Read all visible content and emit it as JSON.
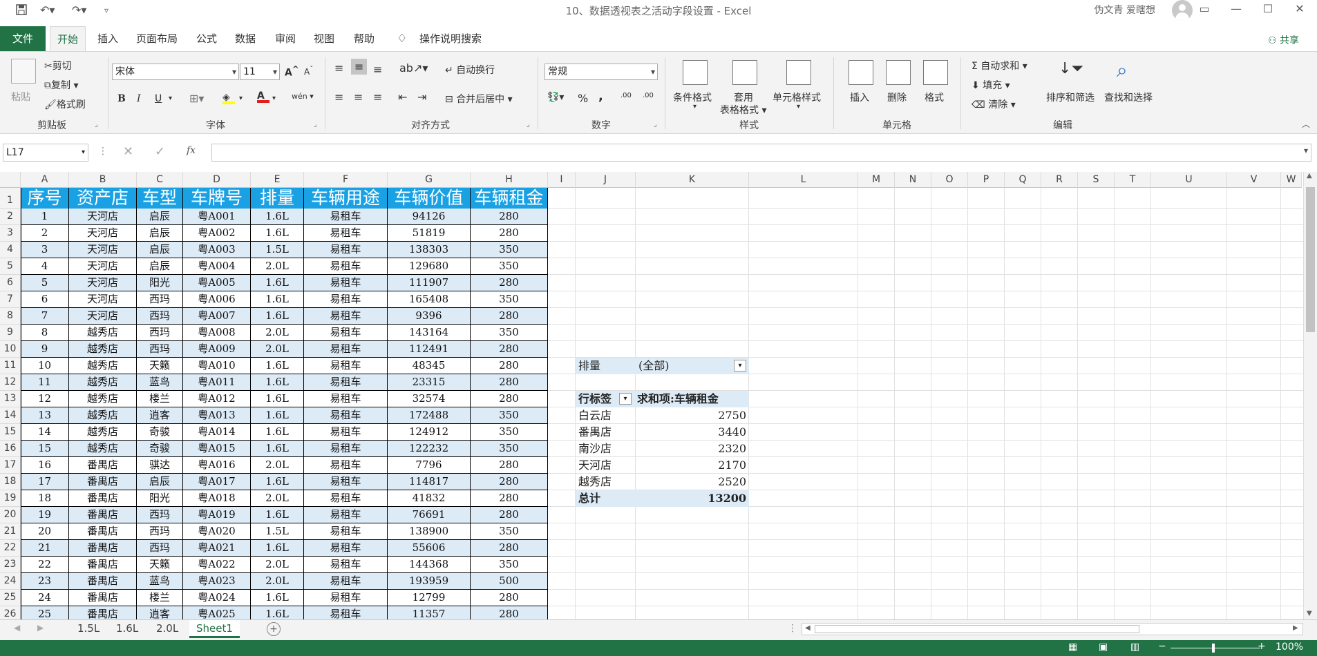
{
  "title_bar": {
    "doc_title": "10、数据透视表之活动字段设置 - Excel",
    "user": "伪文青 爱瞎想",
    "icons": [
      "save-icon",
      "undo-icon",
      "redo-icon",
      "customize-qat-icon",
      "ribbon-display-icon",
      "minimize-icon",
      "maximize-icon",
      "close-icon"
    ]
  },
  "tabs": {
    "file": "文件",
    "items": [
      "开始",
      "插入",
      "页面布局",
      "公式",
      "数据",
      "审阅",
      "视图",
      "帮助"
    ],
    "tell_me": "操作说明搜索",
    "share": "共享"
  },
  "ribbon": {
    "clipboard": {
      "paste": "粘贴",
      "cut": "剪切",
      "copy": "复制",
      "format_painter": "格式刷",
      "label": "剪贴板"
    },
    "font": {
      "name": "宋体",
      "size": "11",
      "label": "字体",
      "bold": "B",
      "italic": "I",
      "underline": "U",
      "grow": "A",
      "shrink": "A",
      "font_color_letter": "A",
      "phonetic": "wén"
    },
    "alignment": {
      "wrap": "自动换行",
      "merge": "合并后居中",
      "label": "对齐方式"
    },
    "number": {
      "format": "常规",
      "percent": "%",
      "comma": ",",
      "inc_dec": ".00",
      "label": "数字"
    },
    "styles": {
      "conditional": "条件格式",
      "table_format_1": "套用",
      "table_format_2": "表格格式",
      "cell_styles": "单元格样式",
      "label": "样式"
    },
    "cells": {
      "insert": "插入",
      "delete": "删除",
      "format": "格式",
      "label": "单元格"
    },
    "editing": {
      "autosum": "自动求和",
      "fill": "填充",
      "clear": "清除",
      "sort_filter": "排序和筛选",
      "find_select": "查找和选择",
      "label": "编辑"
    }
  },
  "formula_bar": {
    "name_box": "L17",
    "fx": "fx",
    "value": ""
  },
  "sheet": {
    "columns": [
      "A",
      "B",
      "C",
      "D",
      "E",
      "F",
      "G",
      "H",
      "I",
      "J",
      "K",
      "L",
      "M",
      "N",
      "O",
      "P",
      "Q",
      "R",
      "S",
      "T",
      "U",
      "V",
      "W"
    ],
    "headers": [
      "序号",
      "资产店",
      "车型",
      "车牌号",
      "排量",
      "车辆用途",
      "车辆价值",
      "车辆租金"
    ],
    "rows": [
      [
        "1",
        "天河店",
        "启辰",
        "粤A001",
        "1.6L",
        "易租车",
        "94126",
        "280"
      ],
      [
        "2",
        "天河店",
        "启辰",
        "粤A002",
        "1.6L",
        "易租车",
        "51819",
        "280"
      ],
      [
        "3",
        "天河店",
        "启辰",
        "粤A003",
        "1.5L",
        "易租车",
        "138303",
        "350"
      ],
      [
        "4",
        "天河店",
        "启辰",
        "粤A004",
        "2.0L",
        "易租车",
        "129680",
        "350"
      ],
      [
        "5",
        "天河店",
        "阳光",
        "粤A005",
        "1.6L",
        "易租车",
        "111907",
        "280"
      ],
      [
        "6",
        "天河店",
        "西玛",
        "粤A006",
        "1.6L",
        "易租车",
        "165408",
        "350"
      ],
      [
        "7",
        "天河店",
        "西玛",
        "粤A007",
        "1.6L",
        "易租车",
        "9396",
        "280"
      ],
      [
        "8",
        "越秀店",
        "西玛",
        "粤A008",
        "2.0L",
        "易租车",
        "143164",
        "350"
      ],
      [
        "9",
        "越秀店",
        "西玛",
        "粤A009",
        "2.0L",
        "易租车",
        "112491",
        "280"
      ],
      [
        "10",
        "越秀店",
        "天籁",
        "粤A010",
        "1.6L",
        "易租车",
        "48345",
        "280"
      ],
      [
        "11",
        "越秀店",
        "蓝鸟",
        "粤A011",
        "1.6L",
        "易租车",
        "23315",
        "280"
      ],
      [
        "12",
        "越秀店",
        "楼兰",
        "粤A012",
        "1.6L",
        "易租车",
        "32574",
        "280"
      ],
      [
        "13",
        "越秀店",
        "逍客",
        "粤A013",
        "1.6L",
        "易租车",
        "172488",
        "350"
      ],
      [
        "14",
        "越秀店",
        "奇骏",
        "粤A014",
        "1.6L",
        "易租车",
        "124912",
        "350"
      ],
      [
        "15",
        "越秀店",
        "奇骏",
        "粤A015",
        "1.6L",
        "易租车",
        "122232",
        "350"
      ],
      [
        "16",
        "番禺店",
        "骐达",
        "粤A016",
        "2.0L",
        "易租车",
        "7796",
        "280"
      ],
      [
        "17",
        "番禺店",
        "启辰",
        "粤A017",
        "1.6L",
        "易租车",
        "114817",
        "280"
      ],
      [
        "18",
        "番禺店",
        "阳光",
        "粤A018",
        "2.0L",
        "易租车",
        "41832",
        "280"
      ],
      [
        "19",
        "番禺店",
        "西玛",
        "粤A019",
        "1.6L",
        "易租车",
        "76691",
        "280"
      ],
      [
        "20",
        "番禺店",
        "西玛",
        "粤A020",
        "1.5L",
        "易租车",
        "138900",
        "350"
      ],
      [
        "21",
        "番禺店",
        "西玛",
        "粤A021",
        "1.6L",
        "易租车",
        "55606",
        "280"
      ],
      [
        "22",
        "番禺店",
        "天籁",
        "粤A022",
        "2.0L",
        "易租车",
        "144368",
        "350"
      ],
      [
        "23",
        "番禺店",
        "蓝鸟",
        "粤A023",
        "2.0L",
        "易租车",
        "193959",
        "500"
      ],
      [
        "24",
        "番禺店",
        "楼兰",
        "粤A024",
        "1.6L",
        "易租车",
        "12799",
        "280"
      ],
      [
        "25",
        "番禺店",
        "逍客",
        "粤A025",
        "1.6L",
        "易租车",
        "11357",
        "280"
      ]
    ],
    "row_numbers": [
      "1",
      "2",
      "3",
      "4",
      "5",
      "6",
      "7",
      "8",
      "9",
      "10",
      "11",
      "12",
      "13",
      "14",
      "15",
      "16",
      "17",
      "18",
      "19",
      "20",
      "21",
      "22",
      "23",
      "24",
      "25",
      "26"
    ]
  },
  "pivot": {
    "filter_label": "排量",
    "filter_value": "(全部)",
    "row_label_header": "行标签",
    "value_header": "求和项:车辆租金",
    "rows": [
      {
        "label": "白云店",
        "value": "2750"
      },
      {
        "label": "番禺店",
        "value": "3440"
      },
      {
        "label": "南沙店",
        "value": "2320"
      },
      {
        "label": "天河店",
        "value": "2170"
      },
      {
        "label": "越秀店",
        "value": "2520"
      }
    ],
    "total_label": "总计",
    "total_value": "13200"
  },
  "sheet_tabs": {
    "items": [
      "1.5L",
      "1.6L",
      "2.0L",
      "Sheet1"
    ],
    "active": "Sheet1"
  },
  "status_bar": {
    "zoom": "100%"
  },
  "colors": {
    "accent": "#217346",
    "header_fill": "#1aa1e4",
    "band_fill": "#ddebf7"
  }
}
